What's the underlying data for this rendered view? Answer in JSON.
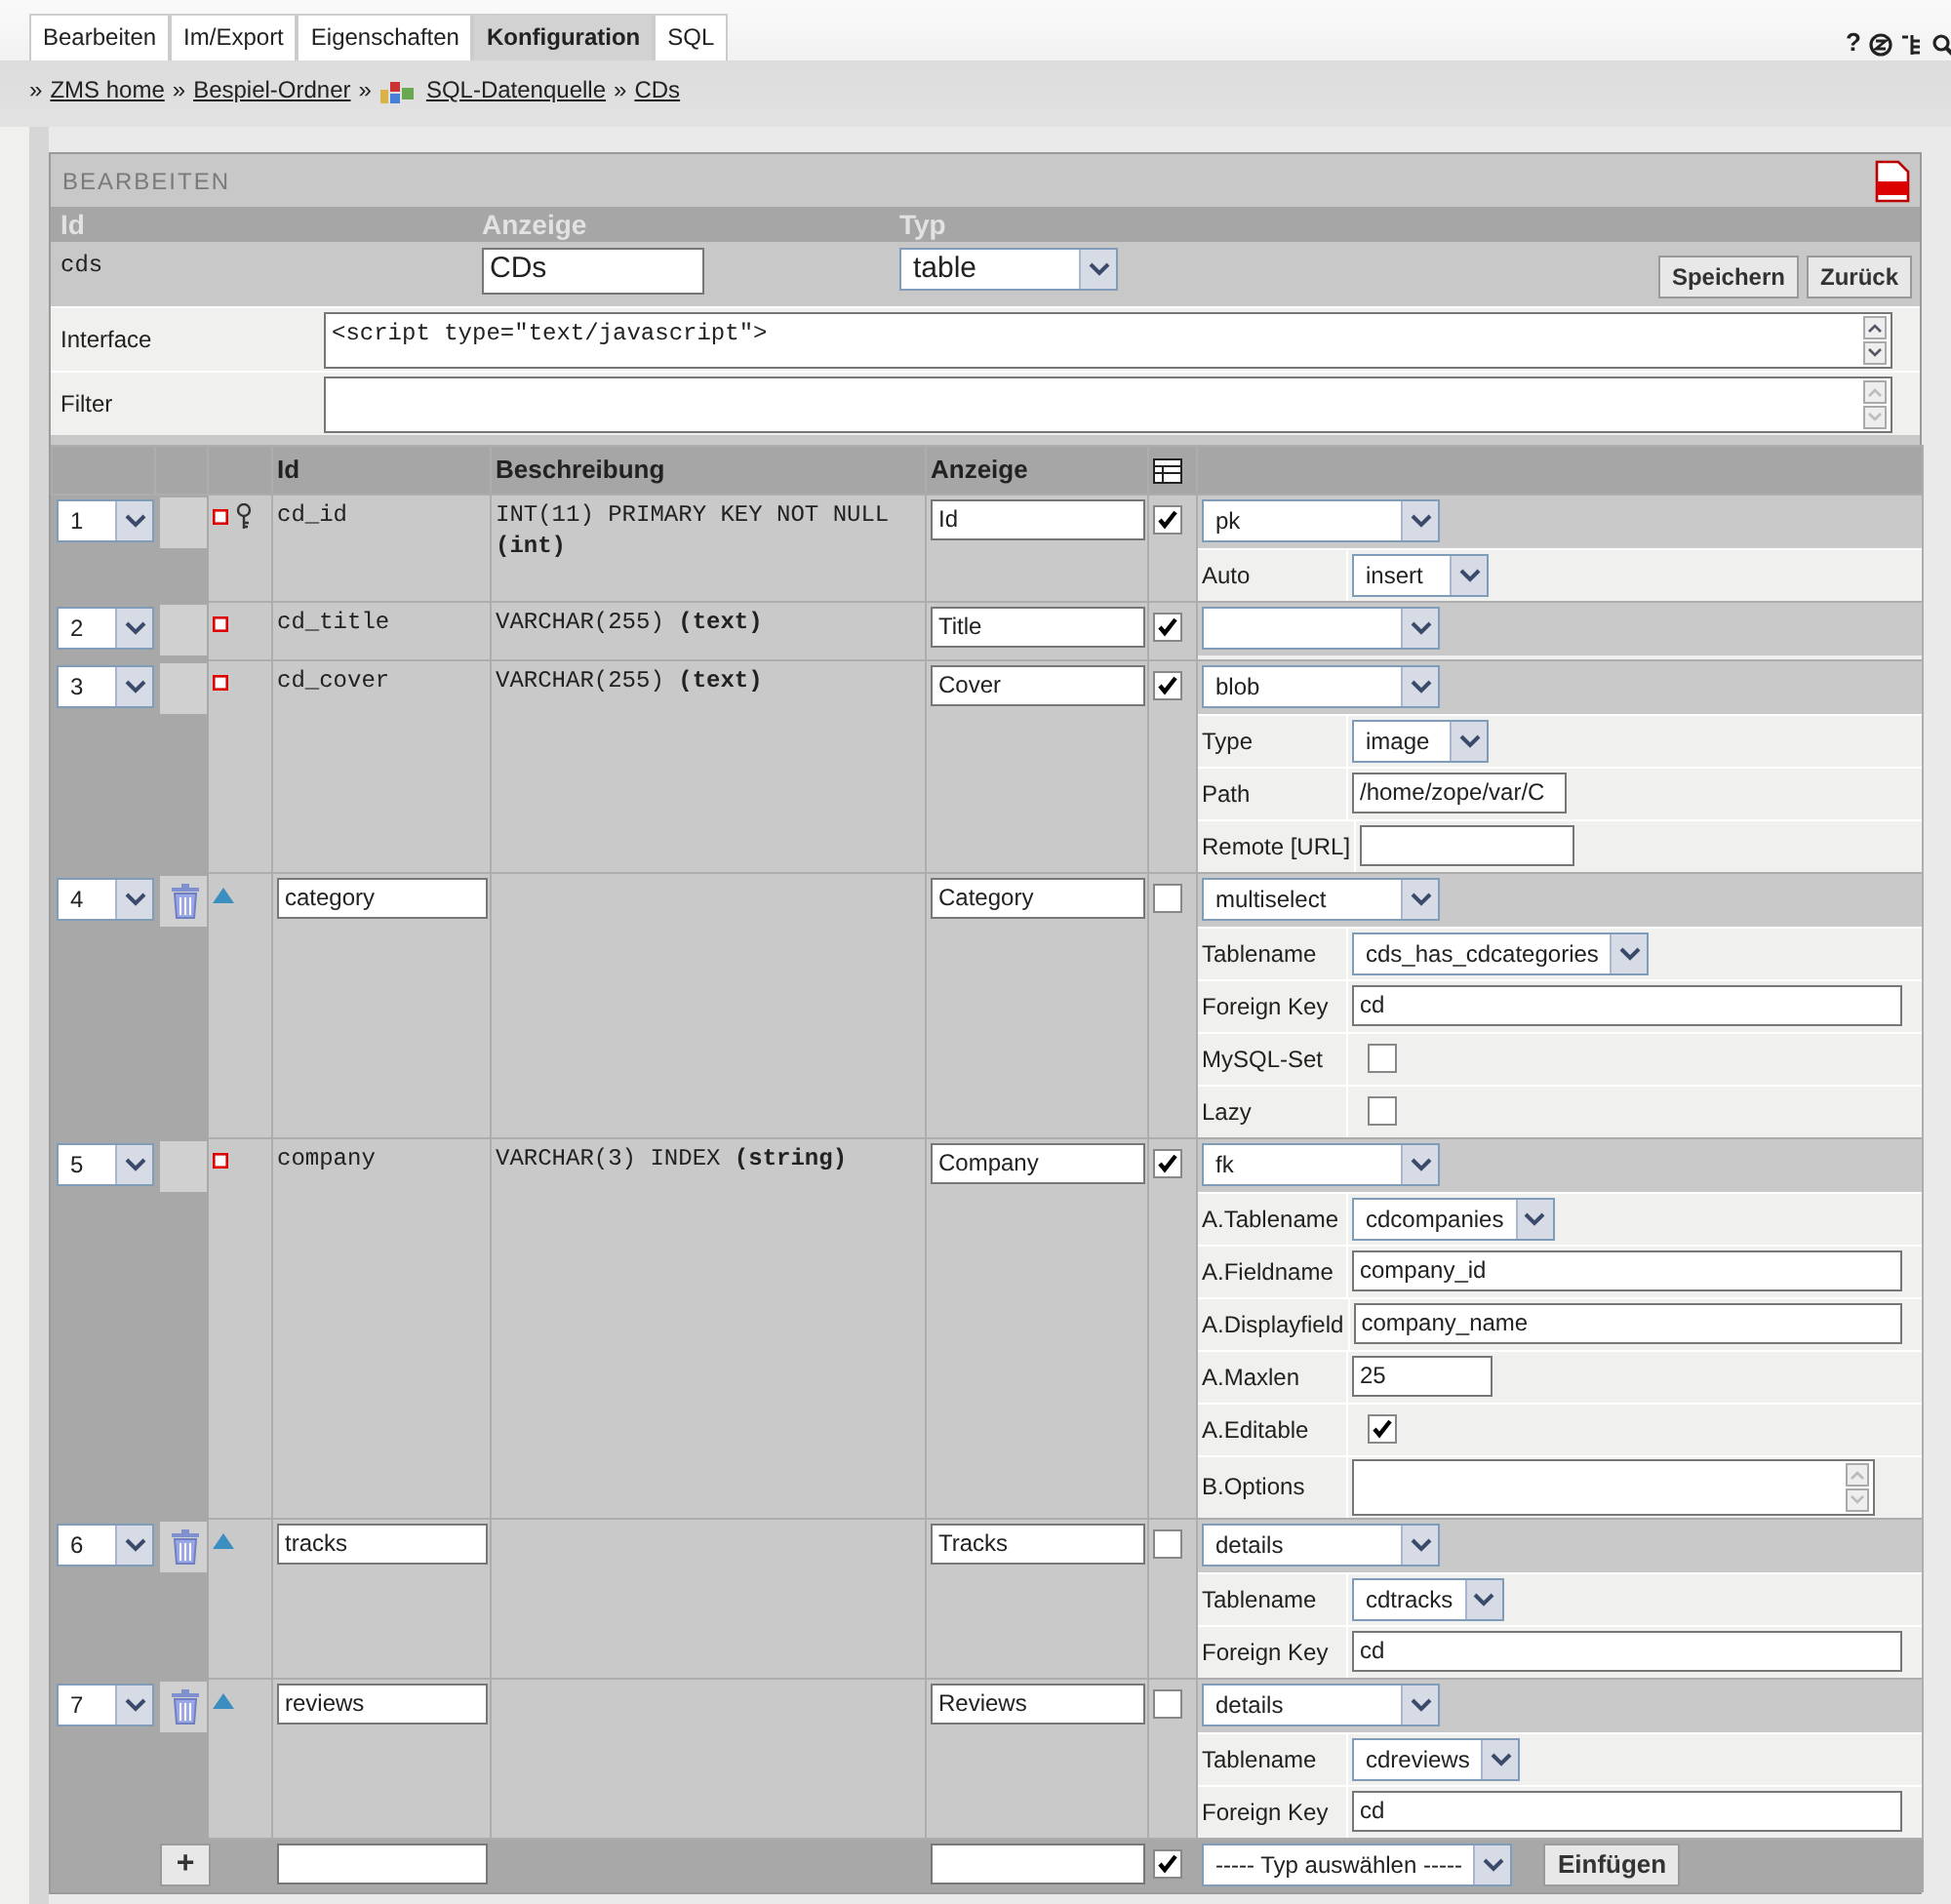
{
  "tabs": [
    {
      "label": "Bearbeiten",
      "selected": false
    },
    {
      "label": "Im/Export",
      "selected": false
    },
    {
      "label": "Eigenschaften",
      "selected": false
    },
    {
      "label": "Konfiguration",
      "selected": true
    },
    {
      "label": "SQL",
      "selected": false
    }
  ],
  "help_label": "?",
  "breadcrumb_separator": "»",
  "breadcrumb": [
    {
      "label": "ZMS home",
      "kind": "link"
    },
    {
      "label": "Bespiel-Ordner",
      "kind": "link"
    },
    {
      "label": "SQL-Datenquelle",
      "kind": "datasource"
    },
    {
      "label": "CDs",
      "kind": "link"
    }
  ],
  "section_title": "BEARBEITEN",
  "meta": {
    "columns": [
      "Id",
      "Anzeige",
      "Typ"
    ],
    "id": "cds",
    "anzeige": "CDs",
    "typ": "table",
    "buttons": [
      "Speichern",
      "Zurück"
    ]
  },
  "interface": {
    "label": "Interface",
    "value": "<script type=\"text/javascript\">"
  },
  "filter": {
    "label": "Filter"
  },
  "grid": {
    "columns": [
      "Id",
      "Beschreibung",
      "Anzeige"
    ],
    "rows": [
      {
        "number": "1",
        "deletable": false,
        "relation": false,
        "key": true,
        "kind": "fixed",
        "id": "cd_id",
        "description": "INT(11) PRIMARY KEY NOT NULL **(int)**",
        "anzeige": "Id",
        "checked": true,
        "type": "pk",
        "attributes": [
          {
            "label": "Auto",
            "kind": "select",
            "value": "insert"
          }
        ]
      },
      {
        "number": "2",
        "deletable": false,
        "relation": false,
        "key": false,
        "kind": "fixed",
        "id": "cd_title",
        "description": "VARCHAR(255) **(text)**",
        "anzeige": "Title",
        "checked": true,
        "attributes": []
      },
      {
        "number": "3",
        "deletable": false,
        "relation": false,
        "key": false,
        "kind": "fixed",
        "id": "cd_cover",
        "description": "VARCHAR(255) **(text)**",
        "anzeige": "Cover",
        "checked": true,
        "type": "blob",
        "attributes": [
          {
            "label": "Type",
            "kind": "select",
            "value": "image"
          },
          {
            "label": "Path",
            "kind": "text",
            "value": "/home/zope/var/C"
          },
          {
            "label": "Remote [URL]",
            "kind": "text"
          }
        ]
      },
      {
        "number": "4",
        "deletable": true,
        "relation": true,
        "key": false,
        "kind": "editable",
        "id": "category",
        "anzeige": "Category",
        "checked": false,
        "type": "multiselect",
        "attributes": [
          {
            "label": "Tablename",
            "kind": "select",
            "value": "cds_has_cdcategories"
          },
          {
            "label": "Foreign Key",
            "kind": "longtext",
            "value": "cd"
          },
          {
            "label": "MySQL-Set",
            "kind": "checkbox",
            "checked": false
          },
          {
            "label": "Lazy",
            "kind": "checkbox",
            "checked": false
          }
        ]
      },
      {
        "number": "5",
        "deletable": false,
        "relation": false,
        "key": false,
        "kind": "fixed",
        "id": "company",
        "description": "VARCHAR(3) INDEX **(string)**",
        "anzeige": "Company",
        "checked": true,
        "type": "fk",
        "attributes": [
          {
            "label": "A.Tablename",
            "kind": "select",
            "value": "cdcompanies"
          },
          {
            "label": "A.Fieldname",
            "kind": "longtext",
            "value": "company_id"
          },
          {
            "label": "A.Displayfield",
            "kind": "longtext",
            "value": "company_name"
          },
          {
            "label": "A.Maxlen",
            "kind": "short",
            "value": "25"
          },
          {
            "label": "A.Editable",
            "kind": "checkbox",
            "checked": true
          },
          {
            "label": "B.Options",
            "kind": "textarea"
          }
        ]
      },
      {
        "number": "6",
        "deletable": true,
        "relation": true,
        "key": false,
        "kind": "editable",
        "id": "tracks",
        "anzeige": "Tracks",
        "checked": false,
        "type": "details",
        "attributes": [
          {
            "label": "Tablename",
            "kind": "select",
            "value": "cdtracks"
          },
          {
            "label": "Foreign Key",
            "kind": "longtext",
            "value": "cd"
          }
        ]
      },
      {
        "number": "7",
        "deletable": true,
        "relation": true,
        "key": false,
        "kind": "editable",
        "id": "reviews",
        "anzeige": "Reviews",
        "checked": false,
        "type": "details",
        "attributes": [
          {
            "label": "Tablename",
            "kind": "select",
            "value": "cdreviews"
          },
          {
            "label": "Foreign Key",
            "kind": "longtext",
            "value": "cd"
          }
        ]
      }
    ],
    "footer": {
      "add_label": "+",
      "checked": true,
      "type_placeholder": "----- Typ auswählen -----",
      "button": "Einfügen"
    }
  }
}
